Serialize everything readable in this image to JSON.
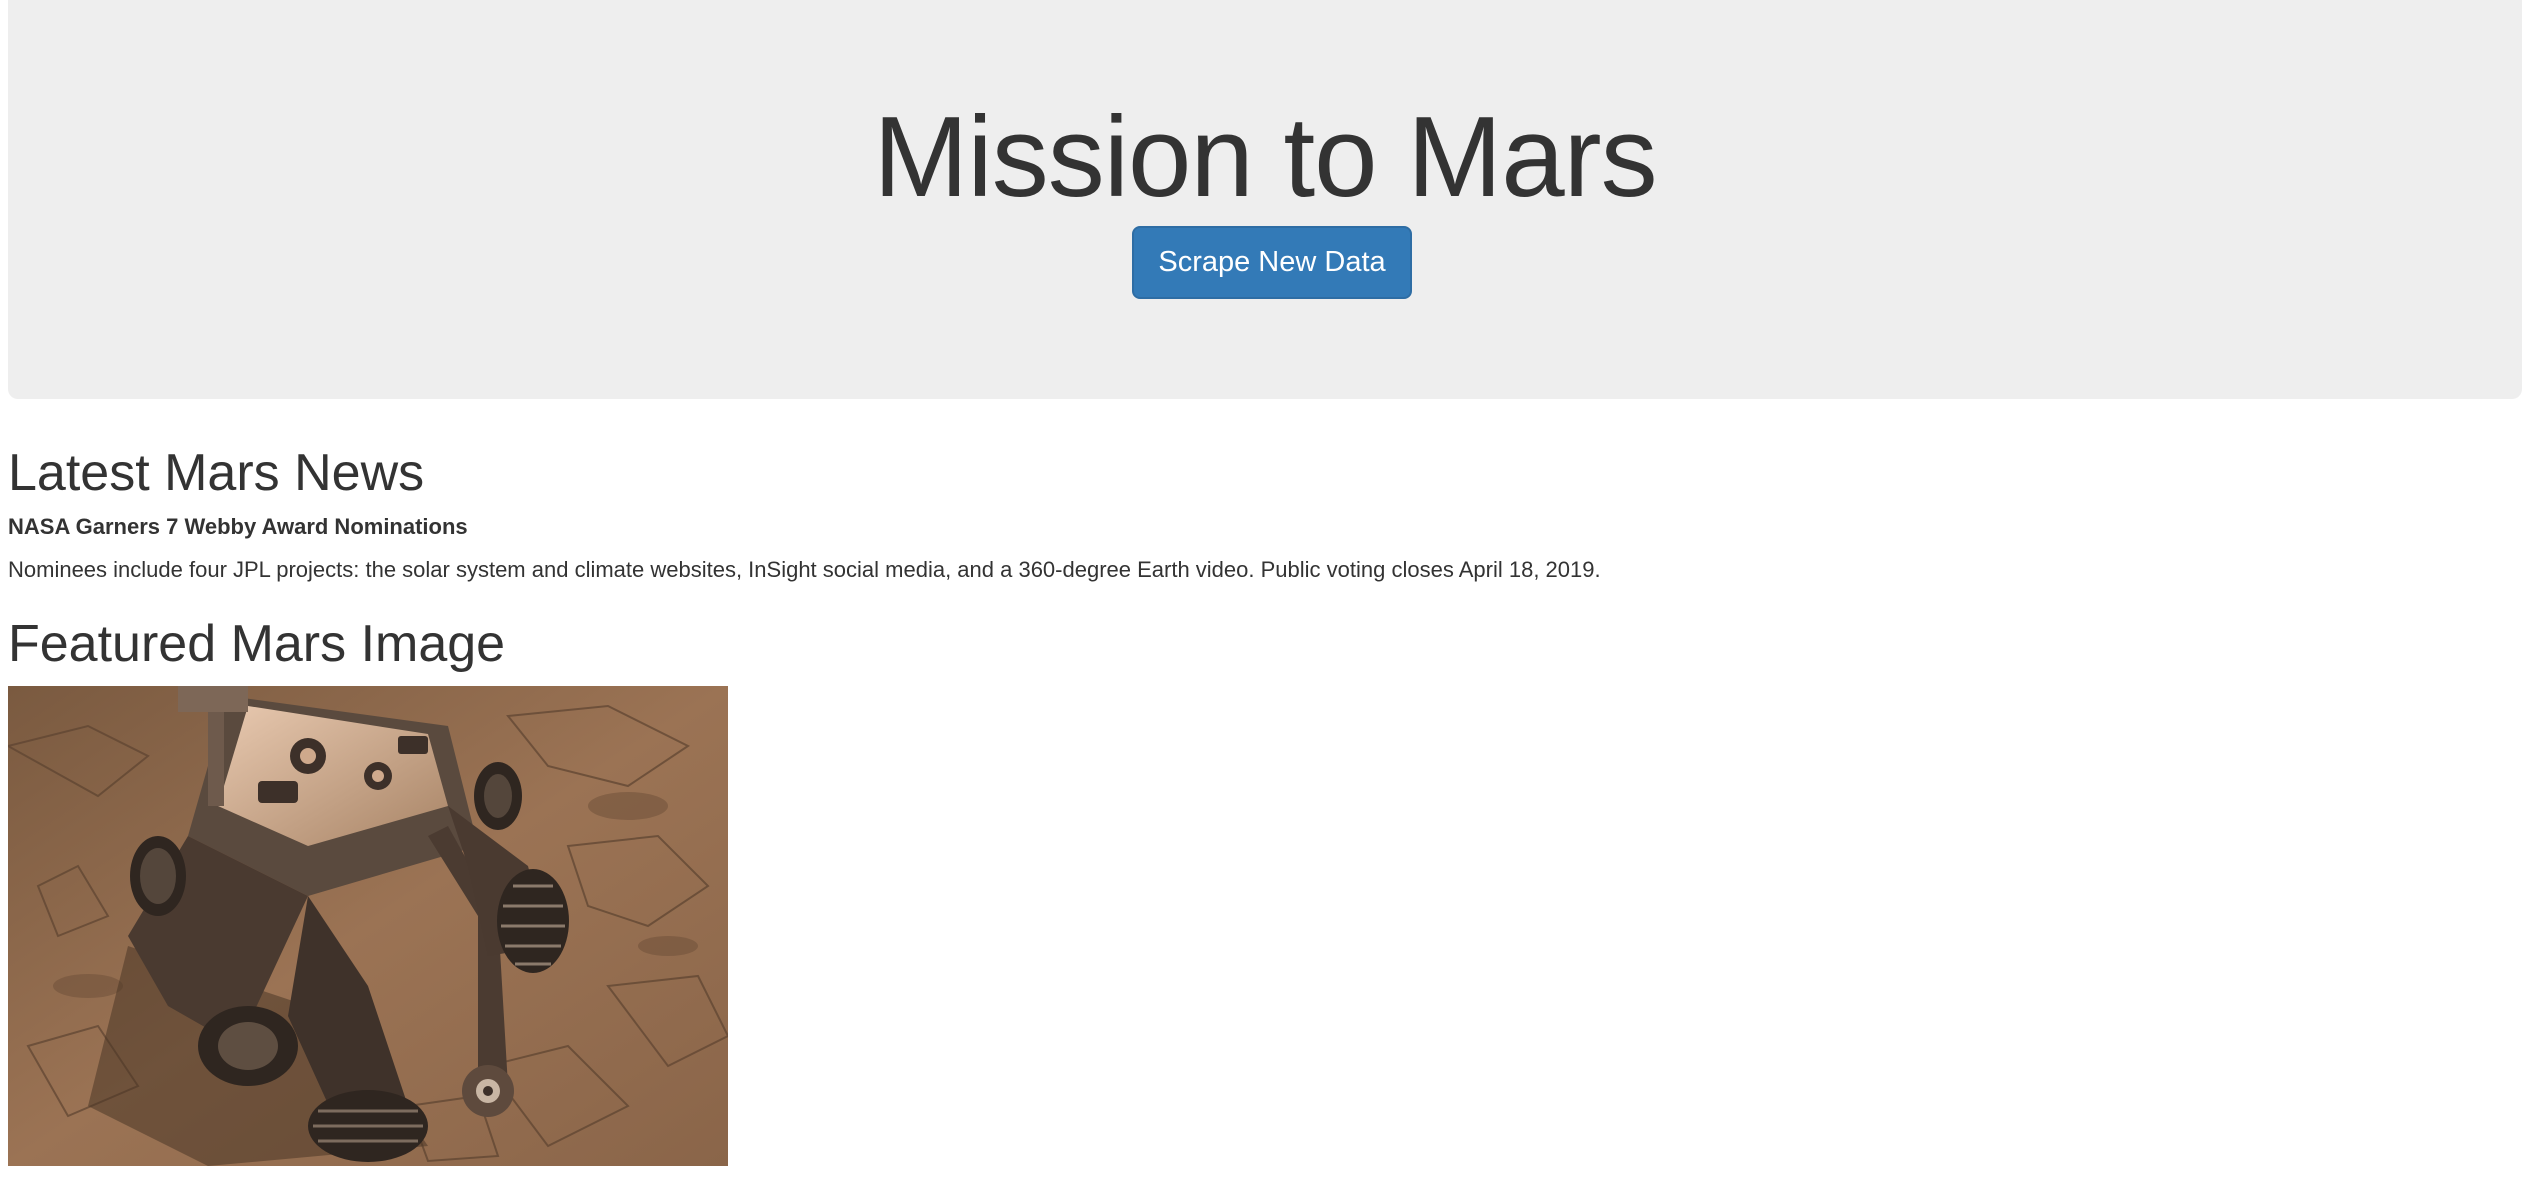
{
  "jumbotron": {
    "title": "Mission to Mars",
    "button_label": "Scrape New Data"
  },
  "news": {
    "heading": "Latest Mars News",
    "title": "NASA Garners 7 Webby Award Nominations",
    "paragraph": "Nominees include four JPL projects: the solar system and climate websites, InSight social media, and a 360-degree Earth video. Public voting closes April 18, 2019."
  },
  "featured_image": {
    "heading": "Featured Mars Image"
  },
  "colors": {
    "jumbotron_bg": "#eeeeee",
    "button_bg": "#337ab7",
    "text": "#333333",
    "mars_soil": "#8f6a4c"
  }
}
